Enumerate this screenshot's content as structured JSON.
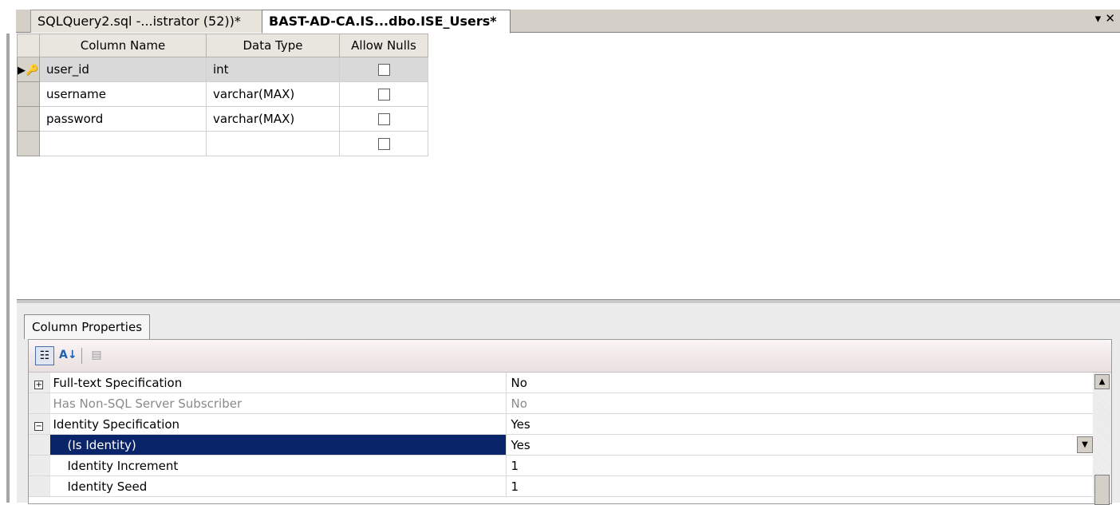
{
  "tabs": [
    {
      "label": "SQLQuery2.sql -...istrator (52))*",
      "active": false
    },
    {
      "label": "BAST-AD-CA.IS...dbo.ISE_Users*",
      "active": true
    }
  ],
  "tab_tools": {
    "dropdown": "▾",
    "close": "✕"
  },
  "grid": {
    "headers": [
      "Column Name",
      "Data Type",
      "Allow Nulls"
    ],
    "rows": [
      {
        "name": "user_id",
        "type": "int",
        "allow_nulls": false,
        "primary_key": true
      },
      {
        "name": "username",
        "type": "varchar(MAX)",
        "allow_nulls": false
      },
      {
        "name": "password",
        "type": "varchar(MAX)",
        "allow_nulls": false
      },
      {
        "name": "",
        "type": "",
        "allow_nulls": false
      }
    ],
    "pk_marker": "▶🔑"
  },
  "properties": {
    "tab_label": "Column Properties",
    "toolbar": {
      "categorized_icon": "categorized-icon",
      "alphabetical_icon": "sort-az-icon",
      "pages_icon": "property-pages-icon"
    },
    "rows": [
      {
        "expander": "+",
        "name": "Full-text Specification",
        "value": "No"
      },
      {
        "expander": "",
        "name": "Has Non-SQL Server Subscriber",
        "value": "No",
        "disabled": true
      },
      {
        "expander": "−",
        "name": "Identity Specification",
        "value": "Yes"
      },
      {
        "expander": "",
        "name": "(Is Identity)",
        "value": "Yes",
        "selected": true
      },
      {
        "expander": "",
        "name": "Identity Increment",
        "value": "1"
      },
      {
        "expander": "",
        "name": "Identity Seed",
        "value": "1"
      }
    ]
  },
  "colors": {
    "selection": "#0a246a",
    "chrome": "#d4d0c8"
  }
}
